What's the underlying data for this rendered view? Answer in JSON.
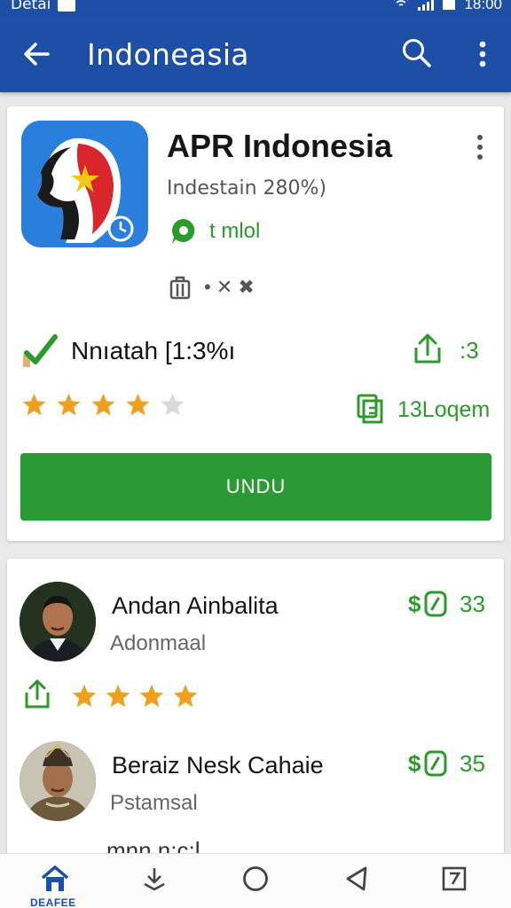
{
  "status_bar": {
    "carrier": "Detai",
    "time": "18:00"
  },
  "app_bar": {
    "title": "Indoneasia"
  },
  "app": {
    "name": "APR Indonesia",
    "subtitle": "Indestain 280%)",
    "badge_text": "t mlol",
    "meta_text": "•   ✕ ✖",
    "rating_percent": "Nnıatah [1:3%ı",
    "share_count": ":3",
    "stars": 4,
    "star_max": 5,
    "copy_label": "13Loqem",
    "install_label": "UNDU"
  },
  "reviews": [
    {
      "name": "Andan Ainbalita",
      "subtitle": "Adonmaal",
      "like_count": "33",
      "stars": 4,
      "like_symbol": "$"
    },
    {
      "name": "Beraiz Nesk Cahaie",
      "subtitle": "Pstamsal",
      "like_count": "35",
      "partial_text": "mnn  n:c:l",
      "like_symbol": "$"
    }
  ],
  "bottom_nav": {
    "home_label": "DEAFEE"
  },
  "colors": {
    "primary": "#1e4fa6",
    "accent": "#2a9a35",
    "star": "#f0a020",
    "star_empty": "#d9d9d9"
  }
}
